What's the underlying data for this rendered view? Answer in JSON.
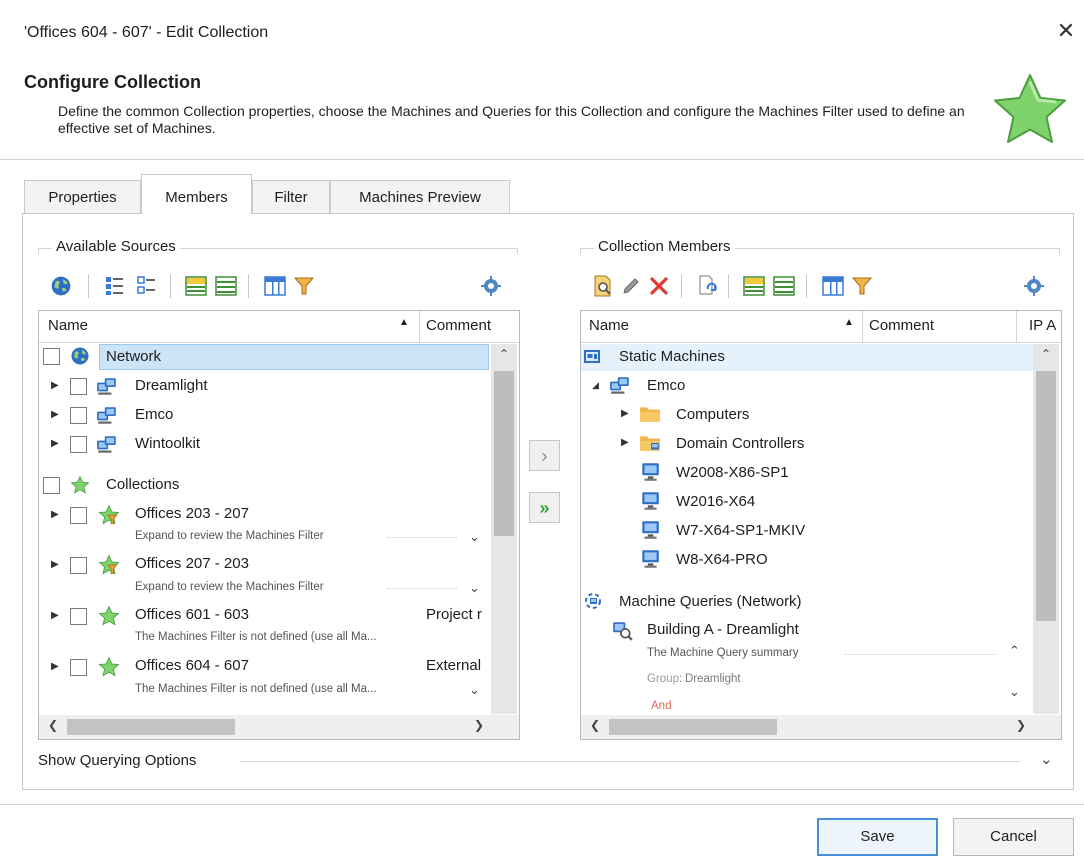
{
  "window": {
    "title": "'Offices 604 - 607' - Edit Collection",
    "close_icon": "close-icon"
  },
  "header": {
    "title": "Configure Collection",
    "description": "Define the common Collection properties, choose the Machines and Queries for this Collection and configure the Machines Filter used to define an effective set of Machines.",
    "icon": "star-icon"
  },
  "tabs": [
    {
      "label": "Properties",
      "active": false
    },
    {
      "label": "Members",
      "active": true
    },
    {
      "label": "Filter",
      "active": false
    },
    {
      "label": "Machines Preview",
      "active": false
    }
  ],
  "available": {
    "group_label": "Available Sources",
    "columns": {
      "name": "Name",
      "comment": "Comment"
    },
    "rows": {
      "network": "Network",
      "dreamlight": "Dreamlight",
      "emco": "Emco",
      "wintoolkit": "Wintoolkit",
      "collections": "Collections",
      "c1_name": "Offices 203 - 207",
      "c1_sub": "Expand to review the Machines Filter",
      "c2_name": "Offices 207 - 203",
      "c2_sub": "Expand to review the Machines Filter",
      "c3_name": "Offices 601 - 603",
      "c3_comment": "Project r",
      "c3_sub": "The Machines Filter is not defined (use all Ma...",
      "c4_name": "Offices 604 - 607",
      "c4_comment": "External",
      "c4_sub": "The Machines Filter is not defined (use all Ma..."
    }
  },
  "members": {
    "group_label": "Collection Members",
    "columns": {
      "name": "Name",
      "comment": "Comment",
      "ip": "IP A"
    },
    "rows": {
      "static": "Static Machines",
      "emco": "Emco",
      "computers": "Computers",
      "dc": "Domain Controllers",
      "m1": "W2008-X86-SP1",
      "m2": "W2016-X64",
      "m3": "W7-X64-SP1-MKIV",
      "m4": "W8-X64-PRO",
      "queries": "Machine Queries (Network)",
      "q1_name": "Building A - Dreamlight",
      "q1_sub": "The Machine Query summary",
      "q1_group_label": "Group:",
      "q1_group_value": "Dreamlight",
      "q1_cut": "And"
    }
  },
  "move_buttons": {
    "add": "›",
    "add_all": "»"
  },
  "querying_options": "Show Querying Options",
  "footer": {
    "save": "Save",
    "cancel": "Cancel"
  },
  "colors": {
    "accent": "#4a90d9",
    "selection": "#cce4f7",
    "star": "#7fd36d",
    "delete": "#e03a2f",
    "folder": "#f0b448",
    "monitor": "#2f6fc3"
  }
}
